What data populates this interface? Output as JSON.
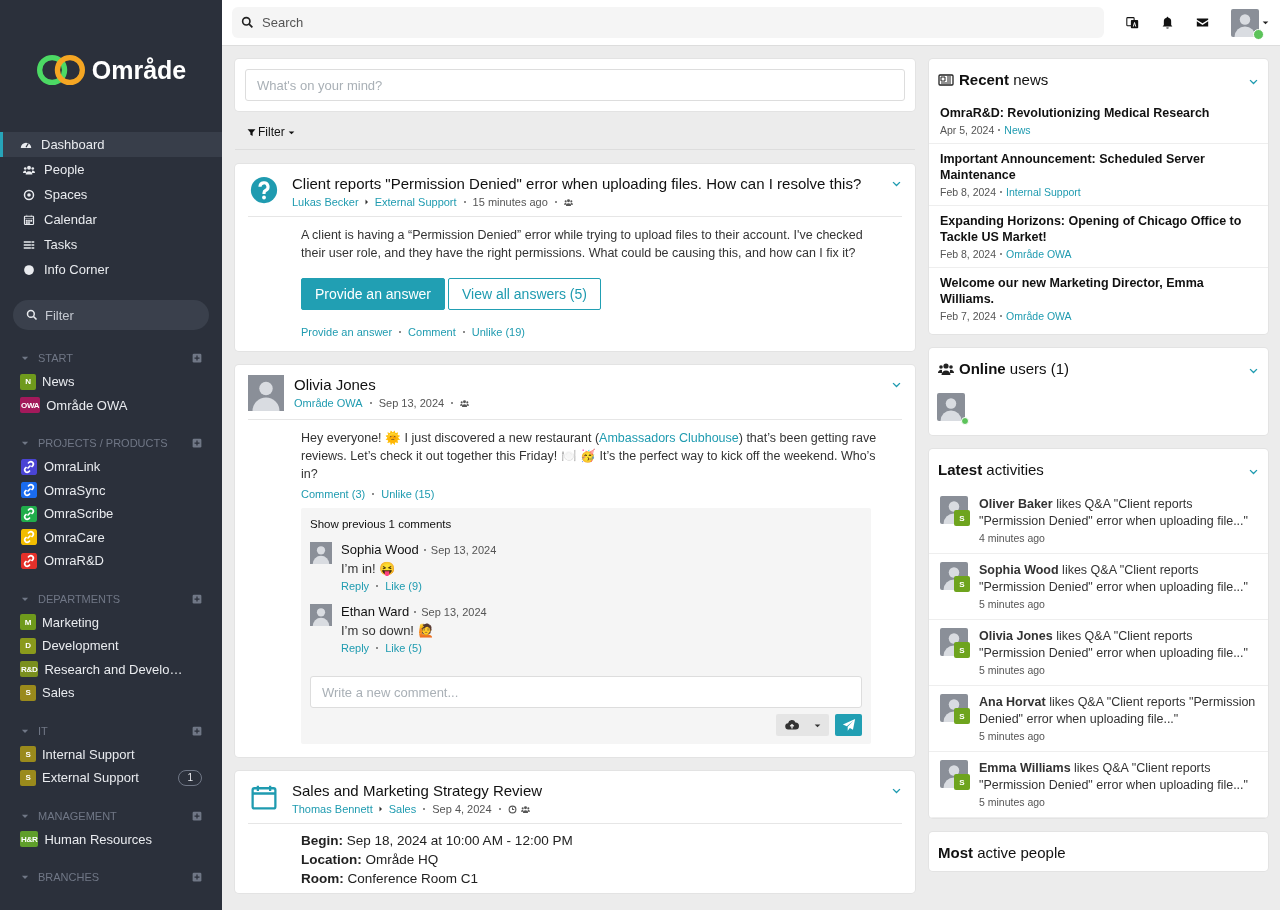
{
  "sidebar": {
    "logo": "Område",
    "nav": [
      {
        "label": "Dashboard",
        "selected": true
      },
      {
        "label": "People",
        "selected": false
      },
      {
        "label": "Spaces",
        "selected": false
      },
      {
        "label": "Calendar",
        "selected": false
      },
      {
        "label": "Tasks",
        "selected": false
      },
      {
        "label": "Info Corner",
        "selected": false
      }
    ],
    "filter": {
      "placeholder": "Filter"
    },
    "sections": [
      {
        "title": "START",
        "expanded": true,
        "items": [
          {
            "kind": "letter",
            "badge": "N",
            "color": "#6f9a1c",
            "name": "News"
          },
          {
            "kind": "letter",
            "badge": "OWA",
            "color": "#a3195b",
            "name": "Område OWA"
          }
        ]
      },
      {
        "title": "PROJECTS / PRODUCTS",
        "expanded": true,
        "items": [
          {
            "kind": "link",
            "color": "#4a44d4",
            "name": "OmraLink"
          },
          {
            "kind": "link",
            "color": "#1a6cf0",
            "name": "OmraSync"
          },
          {
            "kind": "link",
            "color": "#21ad4b",
            "name": "OmraScribe"
          },
          {
            "kind": "link",
            "color": "#f2bd00",
            "name": "OmraCare"
          },
          {
            "kind": "link",
            "color": "#e5302a",
            "name": "OmraR&D"
          }
        ]
      },
      {
        "title": "DEPARTMENTS",
        "expanded": true,
        "items": [
          {
            "kind": "letter",
            "badge": "M",
            "color": "#6f9a1c",
            "name": "Marketing"
          },
          {
            "kind": "letter",
            "badge": "D",
            "color": "#8a9a1c",
            "name": "Development"
          },
          {
            "kind": "letter",
            "badge": "R&D",
            "color": "#7a8f1e",
            "name": "Research and Develo…"
          },
          {
            "kind": "letter",
            "badge": "S",
            "color": "#9a8a1c",
            "name": "Sales"
          }
        ]
      },
      {
        "title": "IT",
        "expanded": true,
        "items": [
          {
            "kind": "letter",
            "badge": "S",
            "color": "#9a8a1c",
            "name": "Internal Support"
          },
          {
            "kind": "letter",
            "badge": "S",
            "color": "#9a8a1c",
            "name": "External Support",
            "count": "1"
          }
        ]
      },
      {
        "title": "MANAGEMENT",
        "expanded": true,
        "items": [
          {
            "kind": "letter",
            "badge": "H&R",
            "color": "#5f9e2a",
            "name": "Human Resources"
          }
        ]
      },
      {
        "title": "BRANCHES",
        "expanded": true
      }
    ]
  },
  "topbar": {
    "search": {
      "placeholder": "Search"
    },
    "user": {
      "online": true
    }
  },
  "composer": {
    "placeholder": "What's on your mind?"
  },
  "filter": {
    "label": "Filter"
  },
  "posts": [
    {
      "kind": "question",
      "title": "Client reports \"Permission Denied\" error when uploading files. How can I resolve this?",
      "author": "Lukas Becker",
      "space": "External Support",
      "time": "15 minutes ago",
      "body": {
        "before": "A client is having a “Permission Denied” error while trying to upload files to their account. I've checked their user role, and they have the right permissions. What could be causing this, and how can I fix it?"
      },
      "buttons": [
        "Provide an answer",
        "View all answers (5)"
      ],
      "actions": [
        "Provide an answer",
        "Comment",
        "Unlike (19)"
      ]
    },
    {
      "kind": "post",
      "title": "Olivia Jones",
      "space": "Område OWA",
      "time": "Sep 13, 2024",
      "body": {
        "before": "Hey everyone! 🌞 I just discovered a new restaurant (",
        "link": "Ambassadors Clubhouse",
        "after": ") that’s been getting rave reviews. Let’s check it out together this Friday! 🍽️ 🥳 It’s the perfect way to kick off the weekend. Who’s in?"
      },
      "actions": [
        "Comment (3)",
        "Unlike (15)"
      ],
      "comments": {
        "show_previous": "Show previous 1 comments",
        "placeholder": "Write a new comment...",
        "items": [
          {
            "author": "Sophia Wood",
            "time": "Sep 13, 2024",
            "text": "I’m in! 😝",
            "actions": [
              "Reply",
              "Like (9)"
            ]
          },
          {
            "author": "Ethan Ward",
            "time": "Sep 13, 2024",
            "text": "I’m so down! 🙋",
            "actions": [
              "Reply",
              "Like (5)"
            ]
          }
        ]
      }
    },
    {
      "kind": "event",
      "title": "Sales and Marketing Strategy Review",
      "author": "Thomas Bennett",
      "space": "Sales",
      "time": "Sep 4, 2024",
      "details": [
        "**Begin:** Sep 18, 2024 at 10:00 AM - 12:00 PM",
        "**Location:** Område HQ",
        "**Room:** Conference Room C1"
      ]
    }
  ],
  "news": {
    "title": "**Recent** news",
    "items": [
      {
        "title": "OmraR&D: Revolutionizing Medical Research",
        "date": "Apr 5, 2024",
        "space": "News"
      },
      {
        "title": "Important Announcement: Scheduled Server Maintenance",
        "date": "Feb 8, 2024",
        "space": "Internal Support"
      },
      {
        "title": "Expanding Horizons: Opening of Chicago Office to Tackle US Market!",
        "date": "Feb 8, 2024",
        "space": "Område OWA"
      },
      {
        "title": "Welcome our new Marketing Director, Emma Williams.",
        "date": "Feb 7, 2024",
        "space": "Område OWA"
      }
    ]
  },
  "online": {
    "title": "**Online** users (1)",
    "users": [
      {
        "online": true
      }
    ]
  },
  "activities": {
    "title": "**Latest** activities",
    "items": [
      {
        "text": "**Oliver Baker** likes Q&A \"Client reports \"Permission Denied\" error when uploading file...\"",
        "badge": "S",
        "time": "4 minutes ago"
      },
      {
        "text": "**Sophia Wood** likes Q&A \"Client reports \"Permission Denied\" error when uploading file...\"",
        "badge": "S",
        "time": "5 minutes ago"
      },
      {
        "text": "**Olivia Jones** likes Q&A \"Client reports \"Permission Denied\" error when uploading file...\"",
        "badge": "S",
        "time": "5 minutes ago"
      },
      {
        "text": "**Ana Horvat** likes Q&A \"Client reports \"Permission Denied\" error when uploading file...\"",
        "badge": "S",
        "time": "5 minutes ago"
      },
      {
        "text": "**Emma Williams** likes Q&A \"Client reports \"Permission Denied\" error when uploading file...\"",
        "badge": "S",
        "time": "5 minutes ago"
      }
    ]
  },
  "most_active": {
    "title": "**Most** active people"
  }
}
